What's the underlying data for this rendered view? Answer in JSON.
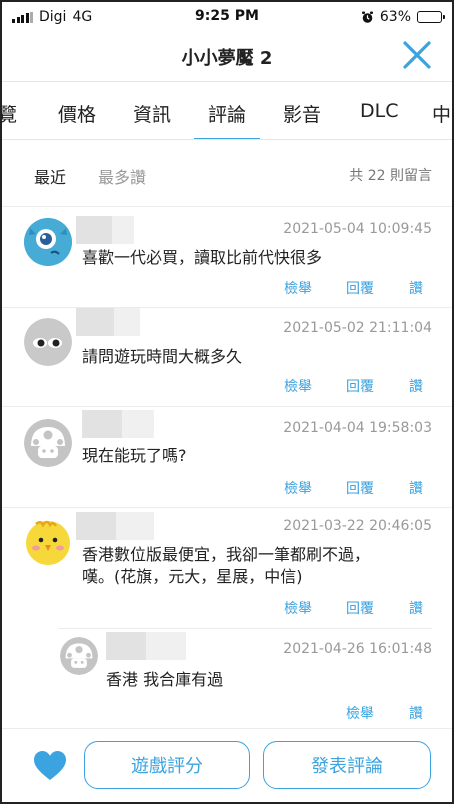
{
  "status_bar": {
    "carrier": "Digi",
    "network": "4G",
    "time": "9:25 PM",
    "battery": "63%",
    "battery_level": 0.63
  },
  "header": {
    "title": "小小夢魘 2",
    "close_icon": "close-icon"
  },
  "tabs": [
    {
      "label": "覽"
    },
    {
      "label": "價格"
    },
    {
      "label": "資訊"
    },
    {
      "label": "評論",
      "active": true
    },
    {
      "label": "影音"
    },
    {
      "label": "DLC"
    },
    {
      "label": "中"
    }
  ],
  "sort": {
    "recent": "最近",
    "most_liked": "最多讚",
    "count": "共 22 則留言"
  },
  "comments": [
    {
      "timestamp": "2021-05-04 10:09:45",
      "text": "喜歡一代必買，讀取比前代快很多",
      "avatar": "blue-monster-avatar",
      "actions": {
        "report": "檢舉",
        "reply": "回覆",
        "like": "讚"
      }
    },
    {
      "timestamp": "2021-05-02 21:11:04",
      "text": "請問遊玩時間大概多久",
      "avatar": "grey-eyes-avatar",
      "actions": {
        "report": "檢舉",
        "reply": "回覆",
        "like": "讚"
      }
    },
    {
      "timestamp": "2021-04-04 19:58:03",
      "text": "現在能玩了嗎?",
      "avatar": "grey-mushroom-avatar",
      "actions": {
        "report": "檢舉",
        "reply": "回覆",
        "like": "讚"
      }
    },
    {
      "timestamp": "2021-03-22 20:46:05",
      "text_line1": "香港數位版最便宜，我卻一筆都刷不過，",
      "text_line2": "嘆。(花旗，元大，星展，中信)",
      "avatar": "yellow-chick-avatar",
      "actions": {
        "report": "檢舉",
        "reply": "回覆",
        "like": "讚"
      }
    }
  ],
  "reply": {
    "timestamp": "2021-04-26 16:01:48",
    "text": "香港 我合庫有過",
    "avatar": "grey-mushroom-avatar",
    "actions": {
      "report": "檢舉",
      "like": "讚"
    }
  },
  "bottom": {
    "rate_label": "遊戲評分",
    "comment_label": "發表評論",
    "heart_icon": "heart-icon"
  },
  "colors": {
    "accent": "#3aa3e0",
    "muted": "#999999"
  }
}
